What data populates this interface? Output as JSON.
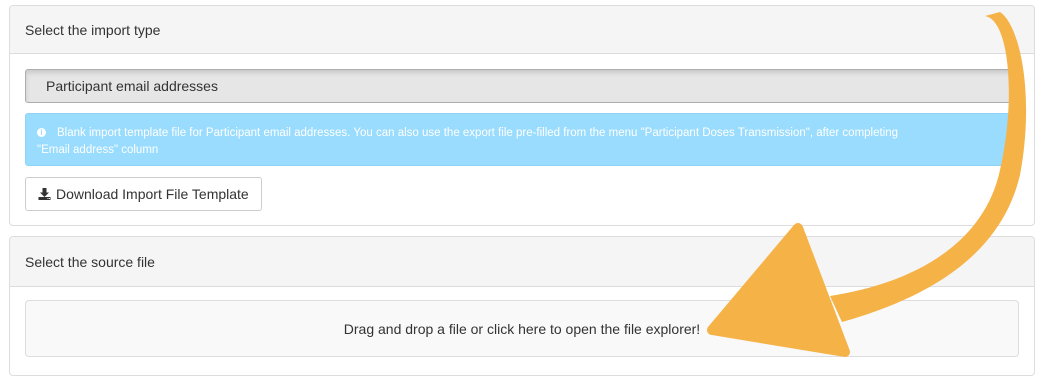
{
  "import_type_panel": {
    "heading": "Select the import type",
    "selected_type": "Participant email addresses",
    "info_text": "Blank import template file for Participant email addresses. You can also use the export file pre-filled from the menu \"Participant Doses Transmission\", after completing",
    "info_text_line2": "\"Email address\" column",
    "download_button_label": "Download Import File Template"
  },
  "source_file_panel": {
    "heading": "Select the source file",
    "dropzone_text": "Drag and drop a file or click here to open the file explorer!"
  },
  "colors": {
    "info_bg": "#99dcfe",
    "arrow": "#f5b247",
    "panel_heading_bg": "#f5f5f5"
  },
  "icons": {
    "info": "info-circle-icon",
    "download": "download-icon",
    "annotation_arrow": "curved-arrow-icon"
  }
}
